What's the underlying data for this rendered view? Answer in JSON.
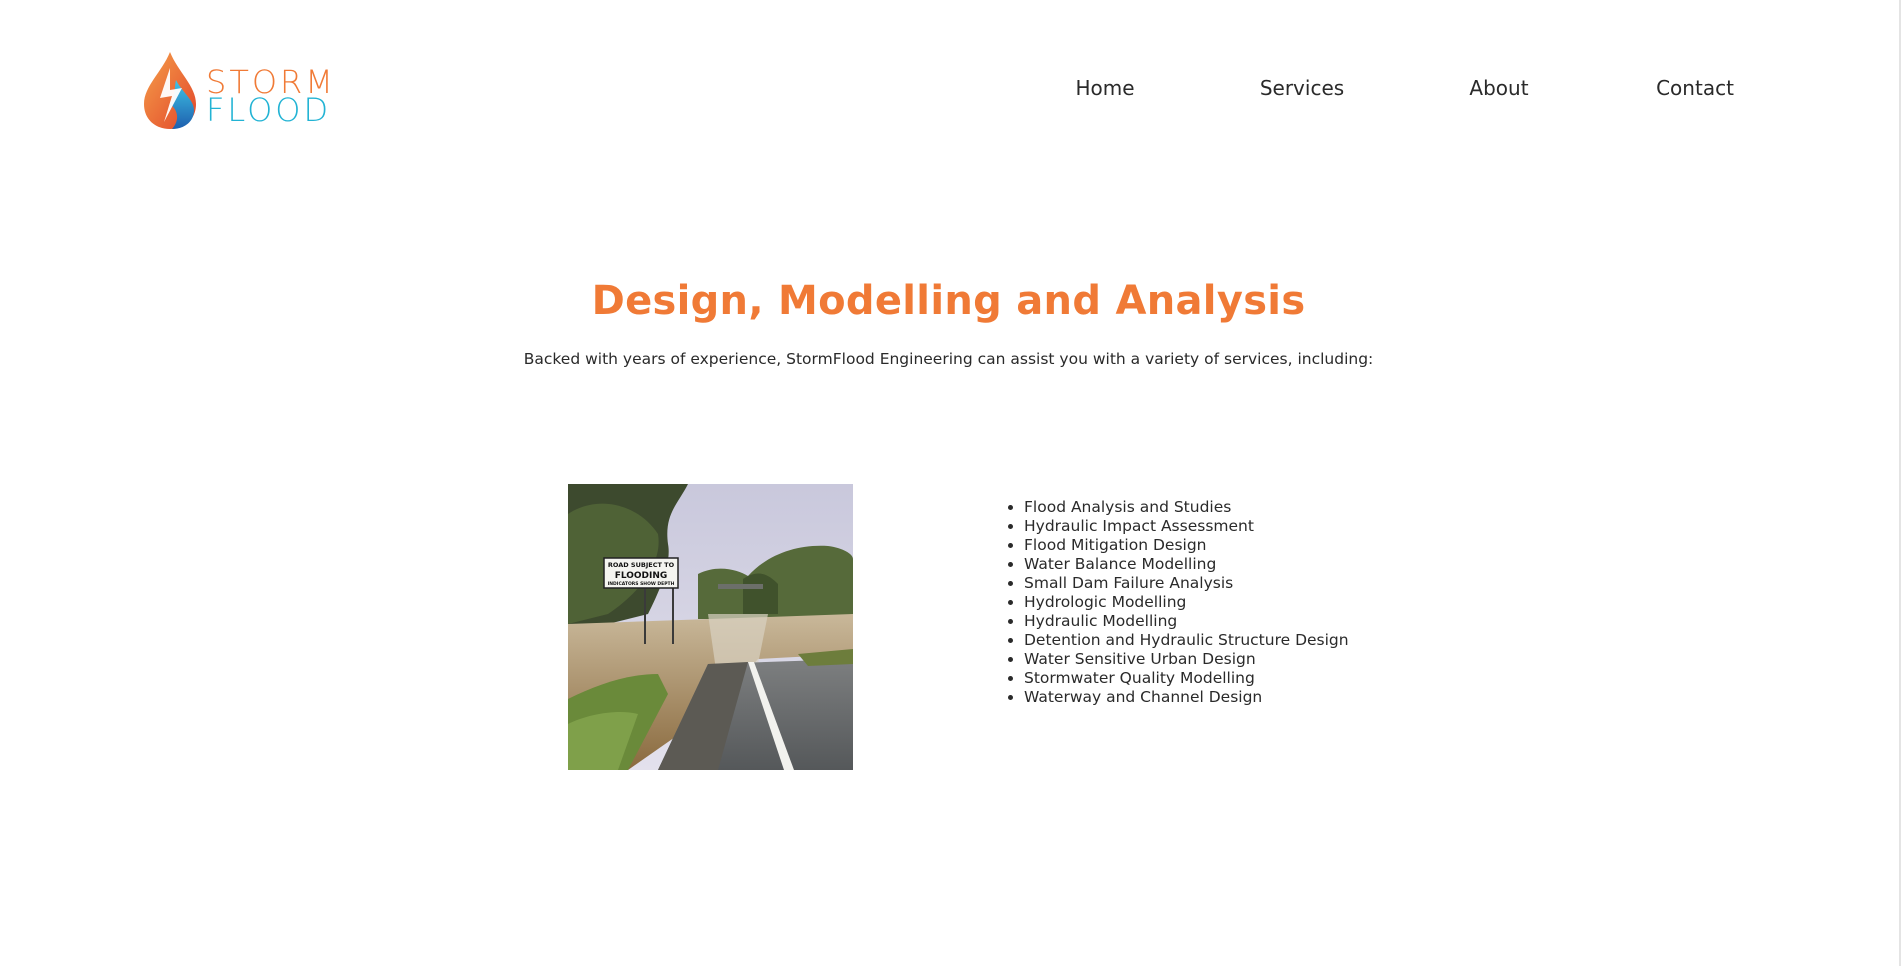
{
  "brand": {
    "word_top": "STORM",
    "word_bottom": "FLOOD",
    "colors": {
      "orange": "#f07a36",
      "cyan": "#22b3d4",
      "blue": "#1e5fae"
    }
  },
  "nav": {
    "items": [
      {
        "label": "Home"
      },
      {
        "label": "Services"
      },
      {
        "label": "About"
      },
      {
        "label": "Contact"
      }
    ]
  },
  "hero": {
    "title": "Design, Modelling and Analysis",
    "intro": "Backed with years of experience, StormFlood Engineering can assist you with a variety of services, including:"
  },
  "photo": {
    "sign_line1": "ROAD SUBJECT TO",
    "sign_line2": "FLOODING",
    "sign_line3": "INDICATORS SHOW DEPTH"
  },
  "services": {
    "items": [
      "Flood Analysis and Studies",
      "Hydraulic Impact Assessment",
      "Flood Mitigation Design",
      "Water Balance Modelling",
      "Small Dam Failure Analysis",
      "Hydrologic Modelling",
      "Hydraulic Modelling",
      "Detention and Hydraulic Structure Design",
      "Water Sensitive Urban Design",
      "Stormwater Quality Modelling",
      "Waterway and Channel Design"
    ]
  }
}
